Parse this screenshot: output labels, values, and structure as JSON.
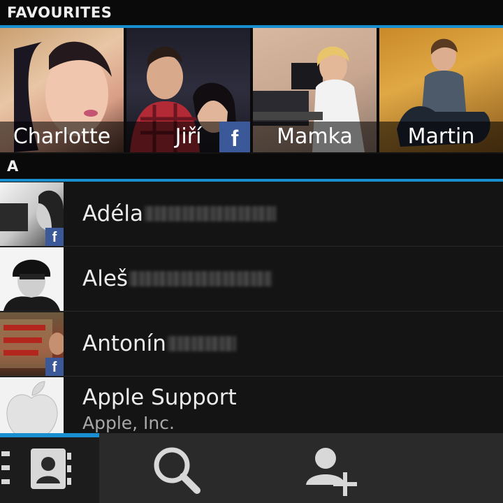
{
  "favourites": {
    "header": "FAVOURITES",
    "items": [
      {
        "name": "Charlotte",
        "facebook": false
      },
      {
        "name": "Jiří",
        "facebook": true
      },
      {
        "name": "Mamka",
        "facebook": false
      },
      {
        "name": "Martin",
        "facebook": false
      }
    ]
  },
  "section_a": {
    "header": "A",
    "contacts": [
      {
        "name": "Adéla",
        "subtitle": "",
        "facebook": true
      },
      {
        "name": "Aleš",
        "subtitle": "",
        "facebook": false
      },
      {
        "name": "Antonín",
        "subtitle": "",
        "facebook": true
      },
      {
        "name": "Apple Support",
        "subtitle": "Apple, Inc.",
        "facebook": false
      }
    ]
  },
  "facebook_badge": "f",
  "toolbar": {
    "icons": [
      "menu-icon",
      "contacts-book-icon",
      "search-icon",
      "add-contact-icon"
    ]
  },
  "colors": {
    "accent": "#1a8fd0",
    "facebook": "#3b5998",
    "background": "#141414"
  }
}
